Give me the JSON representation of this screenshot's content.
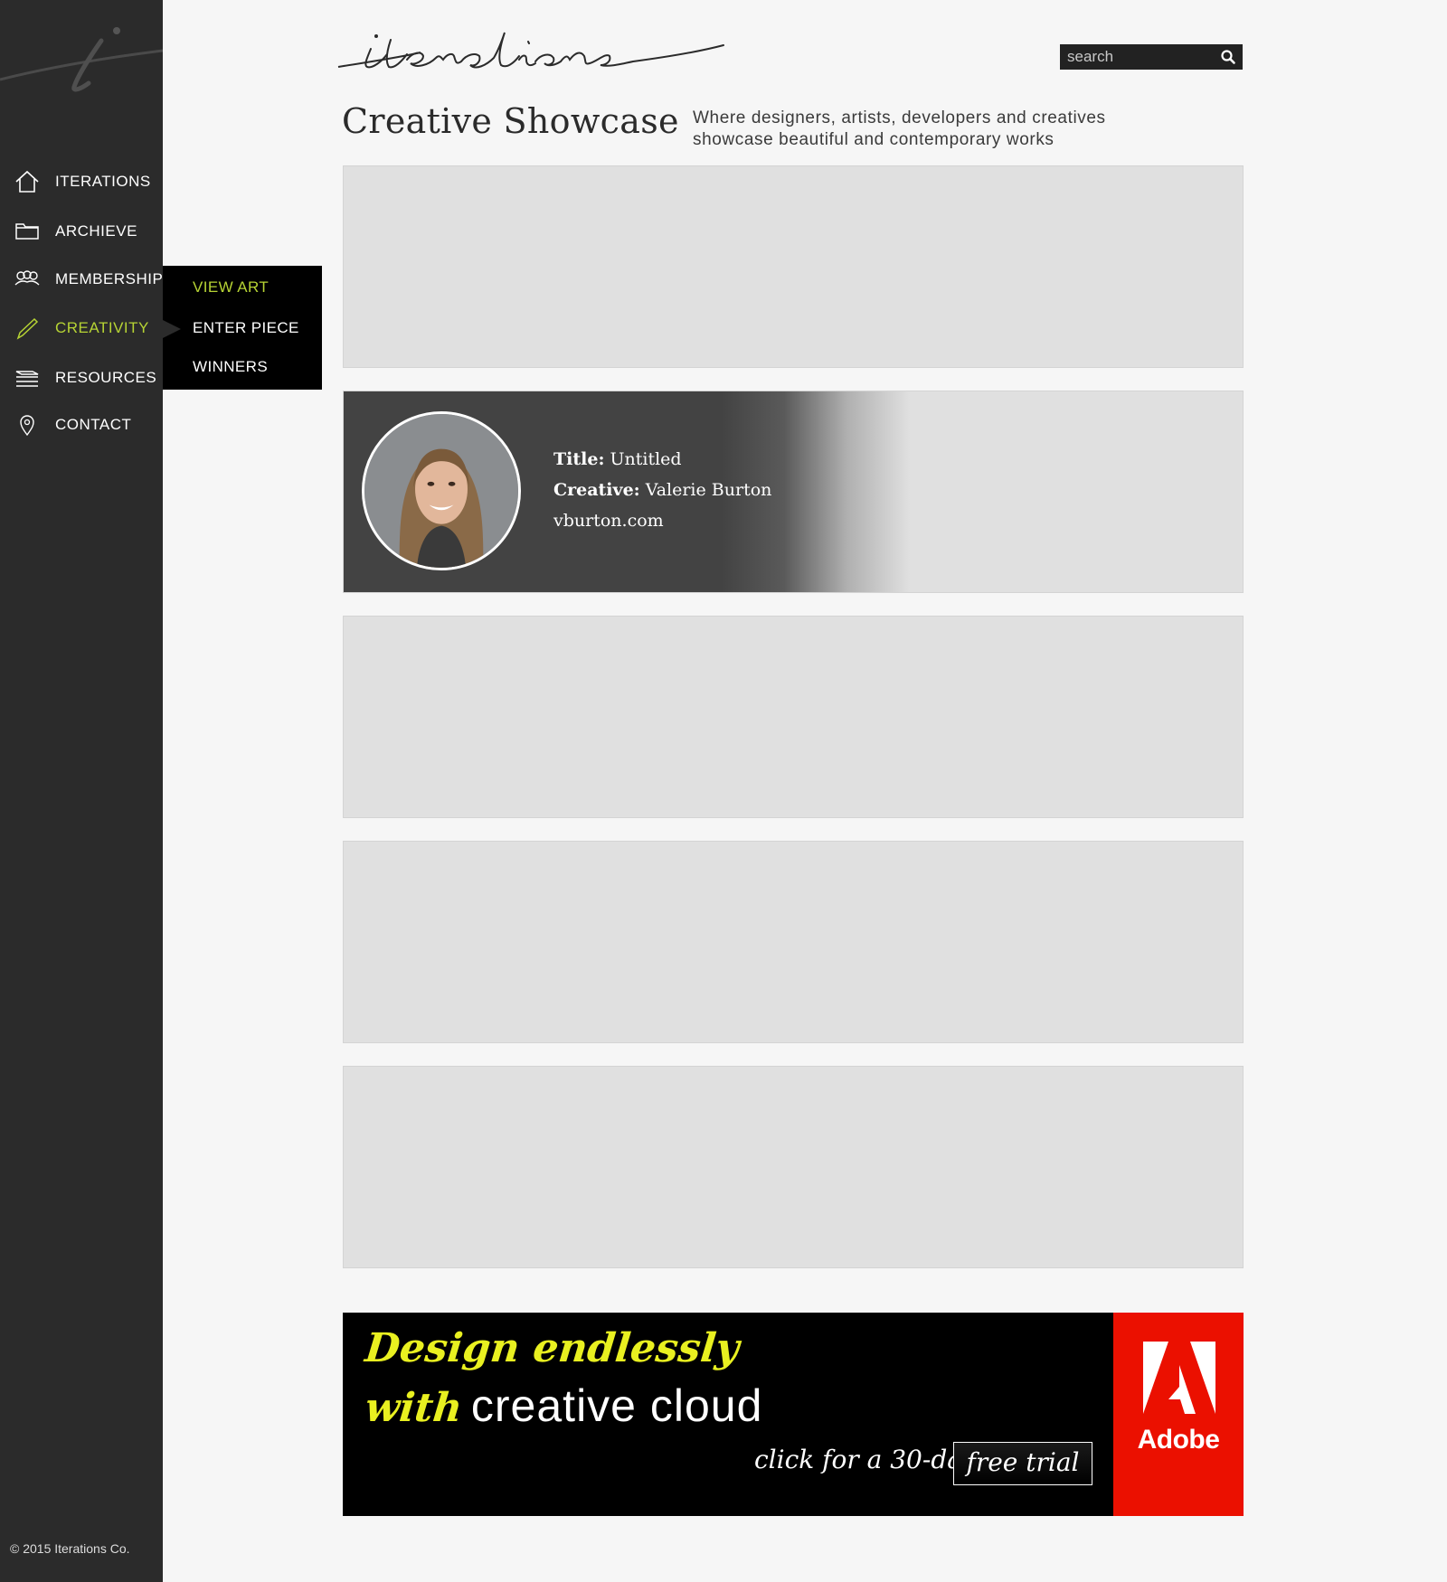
{
  "sidebar": {
    "logo_icon": "iterations-monogram-logo",
    "items": [
      {
        "label": "ITERATIONS",
        "icon": "home-icon"
      },
      {
        "label": "ARCHIEVE",
        "icon": "folder-icon"
      },
      {
        "label": "MEMBERSHIP",
        "icon": "people-icon"
      },
      {
        "label": "CREATIVITY",
        "icon": "pencil-icon"
      },
      {
        "label": "RESOURCES",
        "icon": "stack-icon"
      },
      {
        "label": "CONTACT",
        "icon": "map-pin-icon"
      }
    ],
    "active_item": "CREATIVITY",
    "copyright": "© 2015 Iterations Co."
  },
  "submenu": {
    "items": [
      {
        "label": "VIEW ART"
      },
      {
        "label": "ENTER PIECE"
      },
      {
        "label": "WINNERS"
      }
    ],
    "active_item": "VIEW ART"
  },
  "header": {
    "wordmark": "iterations",
    "search": {
      "placeholder": "search",
      "icon": "search-icon"
    }
  },
  "main": {
    "title": "Creative Showcase",
    "tagline_line1": "Where designers, artists, developers and creatives",
    "tagline_line2": "showcase beautiful and contemporary works",
    "featured": {
      "title_label": "Title:",
      "title_value": "Untitled",
      "creative_label": "Creative:",
      "creative_value": "Valerie Burton",
      "website": "vburton.com",
      "avatar": "creative-portrait"
    }
  },
  "ad": {
    "line1": "Design endlessly",
    "line2_with": "with",
    "line2_rest": "creative cloud",
    "cta": "click for a 30-day",
    "button": "free trial",
    "brand": "Adobe"
  },
  "colors": {
    "sidebar_bg": "#2b2b2b",
    "accent": "#b6d334",
    "card_bg": "#e0e0e0",
    "adobe_red": "#eb1000",
    "ad_yellow": "#e9f020"
  }
}
